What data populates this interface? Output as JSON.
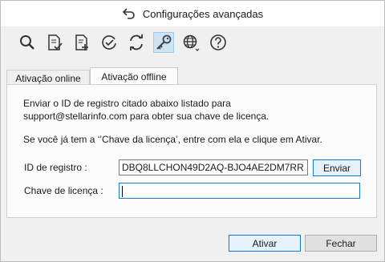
{
  "window": {
    "title": "Configurações avançadas"
  },
  "toolbar": {
    "icons": [
      "search-icon",
      "document-check-icon",
      "document-add-icon",
      "clock-check-icon",
      "refresh-icon",
      "key-icon",
      "globe-icon",
      "help-icon"
    ]
  },
  "tabs": [
    {
      "label": "Ativação online"
    },
    {
      "label": "Ativação offline"
    }
  ],
  "offline": {
    "instruction_line1": "Enviar o ID de registro citado abaixo listado para",
    "instruction_line2": "support@stellarinfo.com para obter sua chave de licença.",
    "instruction_line3": "Se você já tem a ‘’Chave da licença’, entre com ela e clique em Ativar.",
    "registration_label": "ID de registro :",
    "registration_value": "DBQ8LLCHON49D2AQ-BJO4AE2DM7RR",
    "send_label": "Enviar",
    "license_label": "Chave de licença :",
    "license_value": ""
  },
  "footer": {
    "activate_label": "Ativar",
    "close_label": "Fechar"
  },
  "colors": {
    "accent": "#0a78d7",
    "selected_tool": "#cde4f7"
  }
}
